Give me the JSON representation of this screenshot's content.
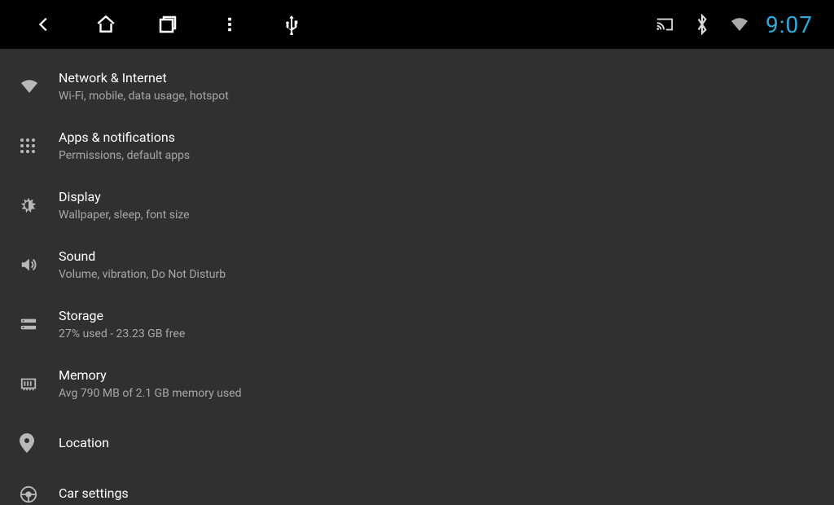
{
  "statusbar": {
    "time": "9:07"
  },
  "settings": [
    {
      "id": "network",
      "title": "Network & Internet",
      "subtitle": "Wi-Fi, mobile, data usage, hotspot"
    },
    {
      "id": "apps",
      "title": "Apps & notifications",
      "subtitle": "Permissions, default apps"
    },
    {
      "id": "display",
      "title": "Display",
      "subtitle": "Wallpaper, sleep, font size"
    },
    {
      "id": "sound",
      "title": "Sound",
      "subtitle": "Volume, vibration, Do Not Disturb"
    },
    {
      "id": "storage",
      "title": "Storage",
      "subtitle": "27% used - 23.23 GB free"
    },
    {
      "id": "memory",
      "title": "Memory",
      "subtitle": "Avg 790 MB of 2.1 GB memory used"
    },
    {
      "id": "location",
      "title": "Location",
      "subtitle": ""
    },
    {
      "id": "car",
      "title": "Car settings",
      "subtitle": ""
    }
  ]
}
